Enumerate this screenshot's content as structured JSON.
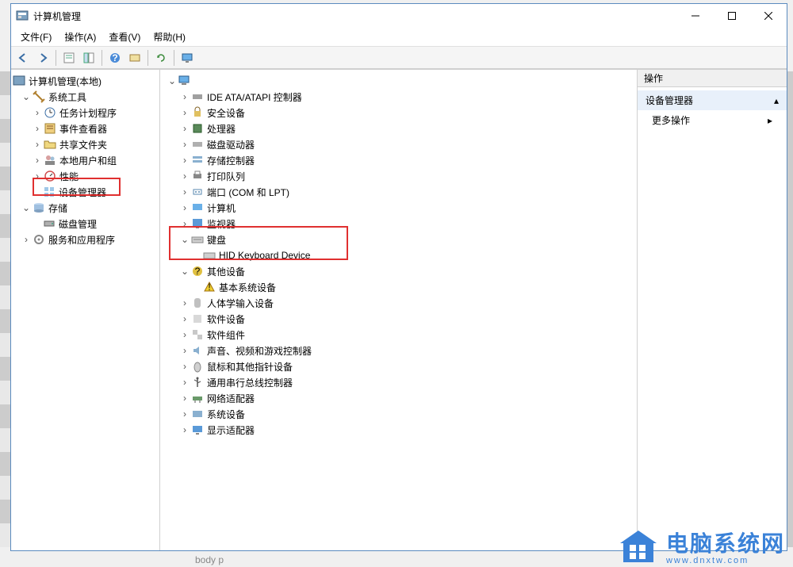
{
  "window": {
    "title": "计算机管理"
  },
  "menus": {
    "file": "文件(F)",
    "action": "操作(A)",
    "view": "查看(V)",
    "help": "帮助(H)"
  },
  "left_tree": {
    "root": "计算机管理(本地)",
    "system_tools": "系统工具",
    "task_scheduler": "任务计划程序",
    "event_viewer": "事件查看器",
    "shared_folders": "共享文件夹",
    "local_users": "本地用户和组",
    "performance": "性能",
    "device_manager": "设备管理器",
    "storage": "存储",
    "disk_mgmt": "磁盘管理",
    "services_apps": "服务和应用程序"
  },
  "dev_tree": {
    "root": "",
    "ide": "IDE ATA/ATAPI 控制器",
    "security": "安全设备",
    "processor": "处理器",
    "disk_drives": "磁盘驱动器",
    "storage_ctrl": "存储控制器",
    "print_queues": "打印队列",
    "ports": "端口 (COM 和 LPT)",
    "computer": "计算机",
    "monitors": "监视器",
    "keyboards": "键盘",
    "hid_kbd": "HID Keyboard Device",
    "other": "其他设备",
    "basic_sys": "基本系统设备",
    "hid_input": "人体学输入设备",
    "soft_dev": "软件设备",
    "soft_comp": "软件组件",
    "sound": "声音、视频和游戏控制器",
    "mouse": "鼠标和其他指针设备",
    "usb": "通用串行总线控制器",
    "network": "网络适配器",
    "system": "系统设备",
    "display": "显示适配器"
  },
  "actions": {
    "header": "操作",
    "title": "设备管理器",
    "more": "更多操作"
  },
  "watermark": {
    "big": "电脑系统网",
    "small": "www.dnxtw.com"
  },
  "footer_left": "body  p"
}
